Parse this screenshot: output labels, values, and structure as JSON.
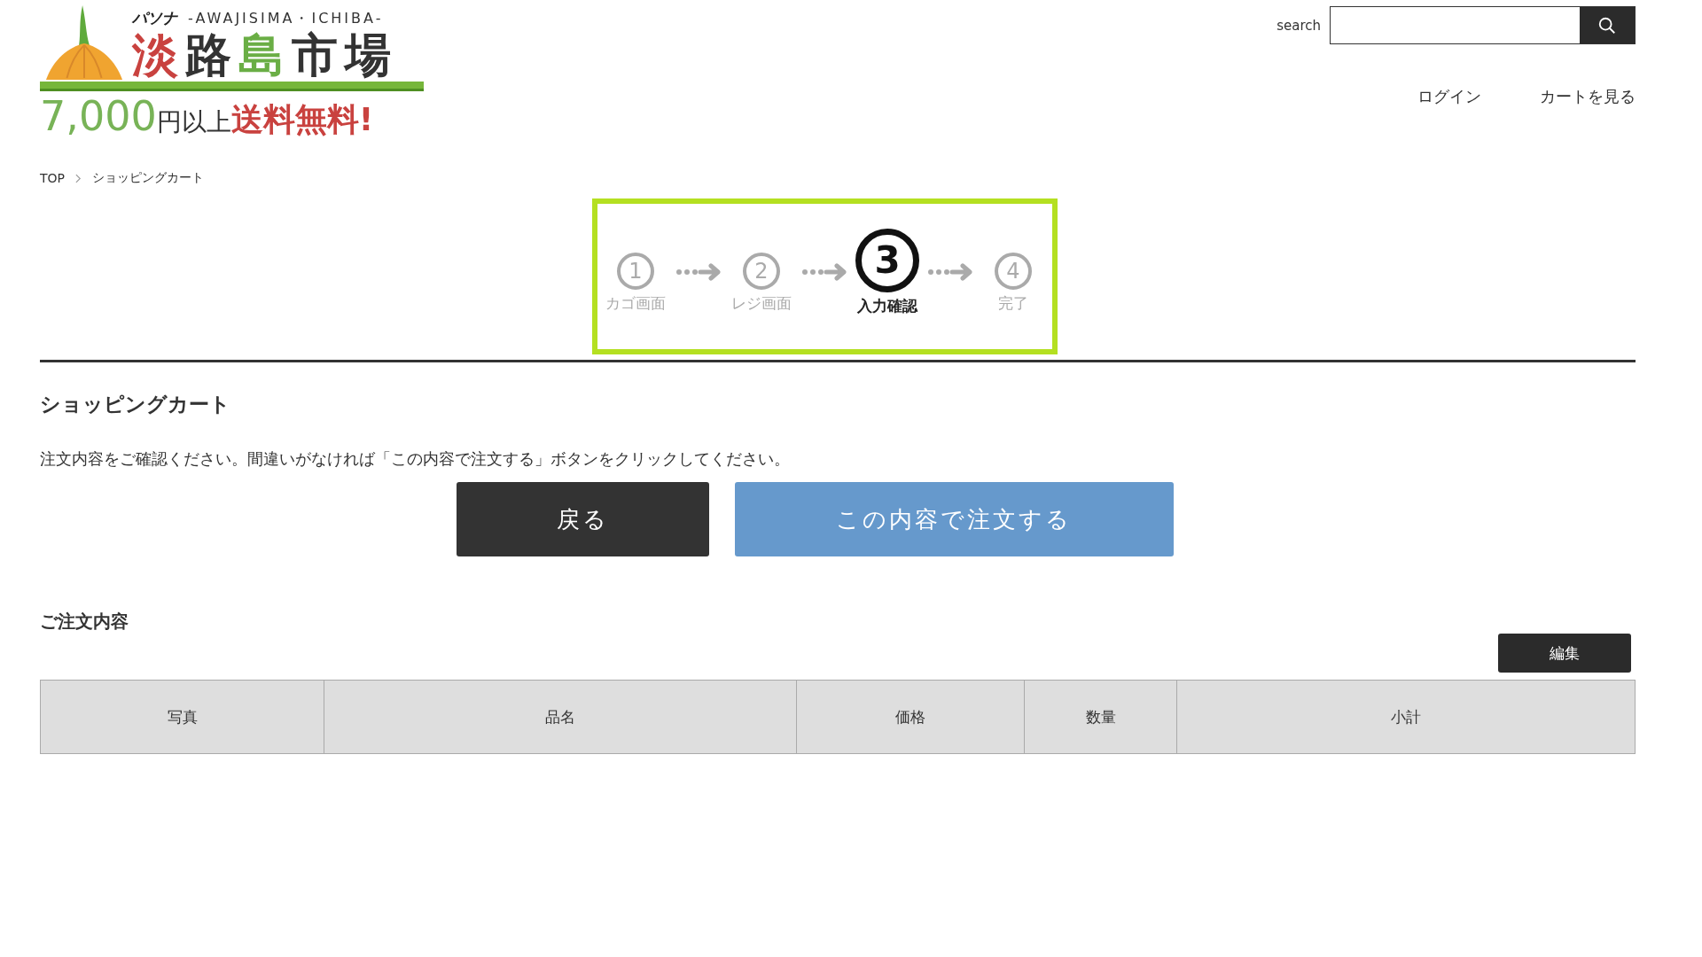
{
  "logo": {
    "brand": "パソナ",
    "subtitle": "-AWAJISIMA・ICHIBA-",
    "title_chars": [
      {
        "text": "淡",
        "color": "#c9423f"
      },
      {
        "text": "路",
        "color": "#333333"
      },
      {
        "text": "島",
        "color": "#6aae45"
      },
      {
        "text": "市",
        "color": "#333333"
      },
      {
        "text": "場",
        "color": "#333333"
      }
    ],
    "tagline": [
      {
        "text": "7,000",
        "color": "#78b357"
      },
      {
        "text": "円以上",
        "color": "#333333"
      },
      {
        "text": "送料無料!",
        "color": "#c9423f"
      }
    ]
  },
  "search": {
    "label": "search"
  },
  "nav": [
    "ログイン",
    "カートを見る"
  ],
  "breadcrumb": [
    "TOP",
    "ショッピングカート"
  ],
  "steps": [
    {
      "number": "1",
      "label": "カゴ画面",
      "selected": false
    },
    {
      "number": "2",
      "label": "レジ画面",
      "selected": false
    },
    {
      "number": "3",
      "label": "入力確認",
      "selected": true
    },
    {
      "number": "4",
      "label": "完了",
      "selected": false
    }
  ],
  "heading": "ショッピングカート",
  "message": "注文内容をご確認ください。間違いがなければ「この内容で注文する」ボタンをクリックしてください。",
  "buttons": [
    {
      "label": "戻る",
      "kind": "back"
    },
    {
      "label": "この内容で注文する",
      "kind": "order"
    }
  ],
  "order": {
    "heading": "ご注文内容",
    "edit_button": "編集",
    "table": {
      "columns": [
        "写真",
        "品名",
        "価格",
        "数量",
        "小計"
      ]
    }
  }
}
